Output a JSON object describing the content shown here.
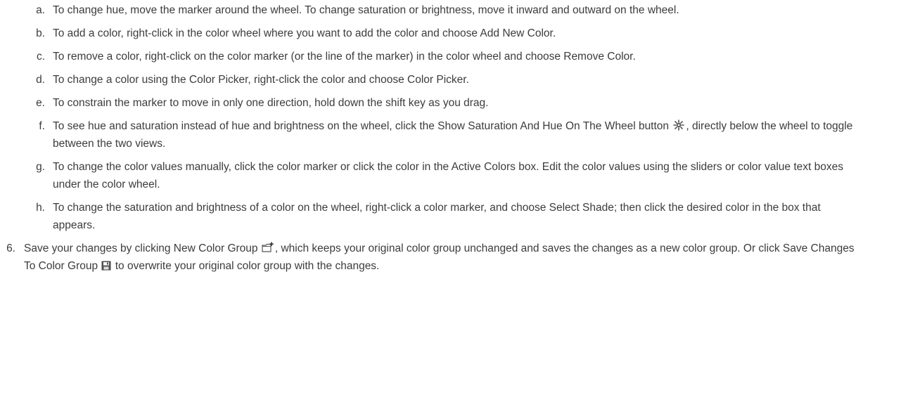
{
  "sub_items": [
    {
      "marker": "a.",
      "parts": [
        "To change hue, move the marker around the wheel. To change saturation or brightness, move it inward and outward on the wheel."
      ]
    },
    {
      "marker": "b.",
      "parts": [
        "To add a color, right-click in the color wheel where you want to add the color and choose Add New Color."
      ]
    },
    {
      "marker": "c.",
      "parts": [
        "To remove a color, right-click on the color marker (or the line of the marker) in the color wheel and choose Remove Color."
      ]
    },
    {
      "marker": "d.",
      "parts": [
        "To change a color using the Color Picker, right-click the color and choose Color Picker."
      ]
    },
    {
      "marker": "e.",
      "parts": [
        "To constrain the marker to move in only one direction, hold down the shift key as you drag."
      ]
    },
    {
      "marker": "f.",
      "parts": [
        "To see hue and saturation instead of hue and brightness on the wheel, click the Show Saturation And Hue On The Wheel button ",
        ", directly below the wheel to toggle between the two views."
      ],
      "icon": "sun-brightness-icon"
    },
    {
      "marker": "g.",
      "parts": [
        "To change the color values manually, click the color marker or click the color in the Active Colors box. Edit the color values using the sliders or color value text boxes under the color wheel."
      ]
    },
    {
      "marker": "h.",
      "parts": [
        "To change the saturation and brightness of a color on the wheel, right-click a color marker, and choose Select Shade; then click the desired color in the box that appears."
      ]
    }
  ],
  "main_item": {
    "marker": "6.",
    "part1": "Save your changes by clicking New Color Group ",
    "part2": ", which keeps your original color group unchanged and saves the changes as a new color group. Or click Save Changes To Color Group ",
    "part3": " to overwrite your original color group with the changes.",
    "icons": [
      "new-color-group-icon",
      "save-disk-icon"
    ]
  }
}
